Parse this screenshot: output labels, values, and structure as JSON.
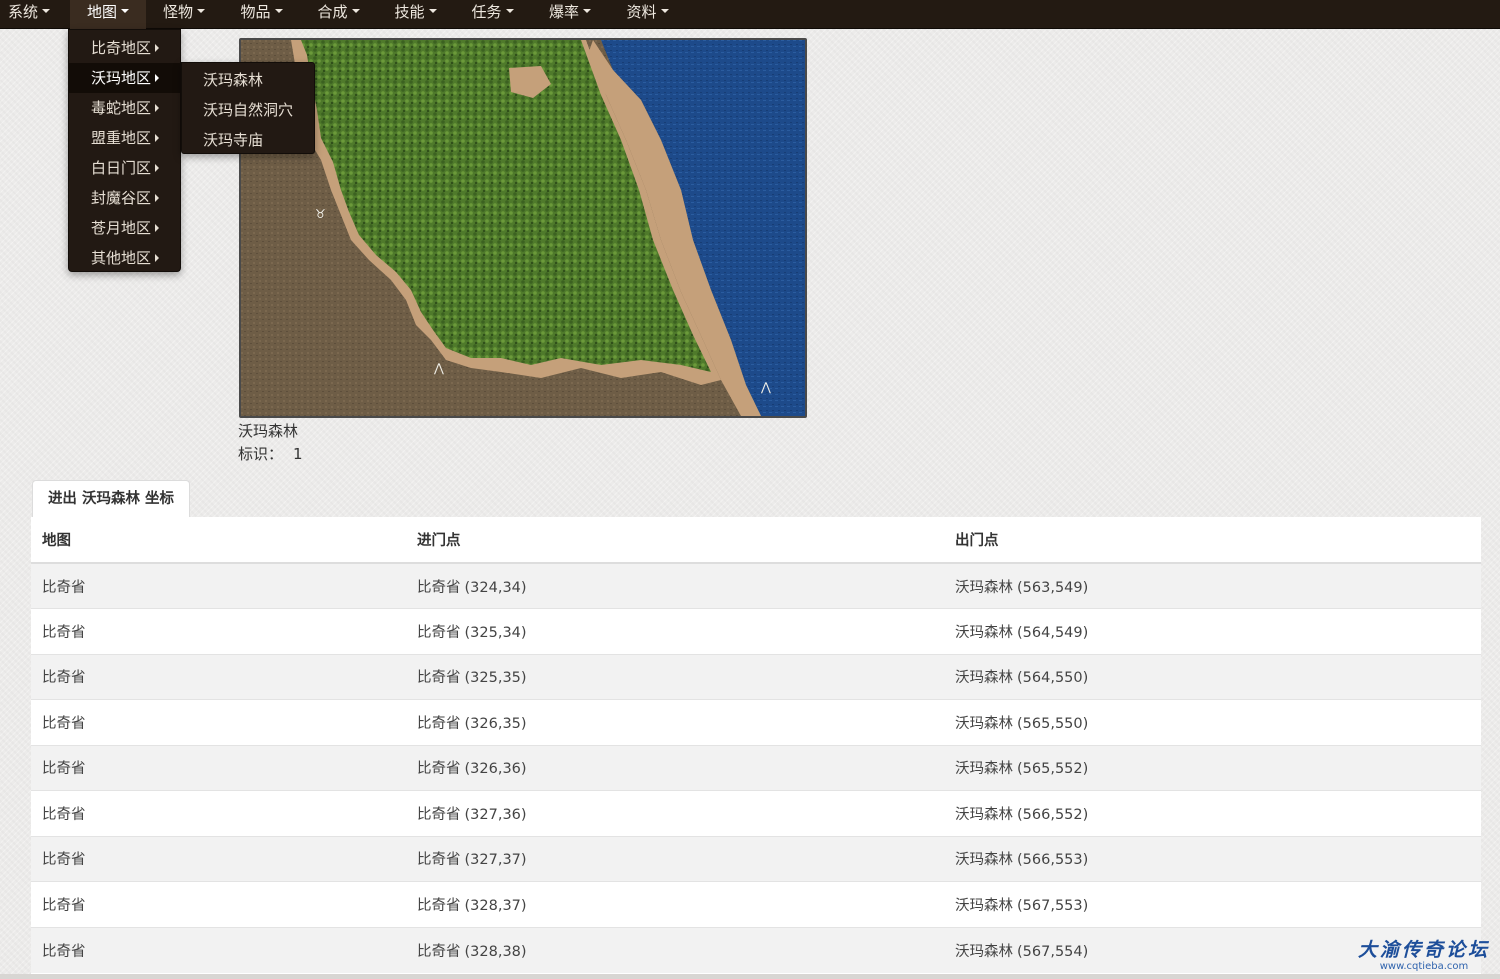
{
  "nav": {
    "items": [
      {
        "label": "系统"
      },
      {
        "label": "地图"
      },
      {
        "label": "怪物"
      },
      {
        "label": "物品"
      },
      {
        "label": "合成"
      },
      {
        "label": "技能"
      },
      {
        "label": "任务"
      },
      {
        "label": "爆率"
      },
      {
        "label": "资料"
      }
    ],
    "active": "地图"
  },
  "dropdown": {
    "items": [
      {
        "label": "比奇地区"
      },
      {
        "label": "沃玛地区"
      },
      {
        "label": "毒蛇地区"
      },
      {
        "label": "盟重地区"
      },
      {
        "label": "白日门区"
      },
      {
        "label": "封魔谷区"
      },
      {
        "label": "苍月地区"
      },
      {
        "label": "其他地区"
      }
    ],
    "active": "沃玛地区"
  },
  "submenu": {
    "items": [
      {
        "label": "沃玛森林"
      },
      {
        "label": "沃玛自然洞穴"
      },
      {
        "label": "沃玛寺庙"
      }
    ]
  },
  "map": {
    "name": "沃玛森林",
    "id_label": "标识：",
    "id_value": "1"
  },
  "tab": {
    "label": "进出 沃玛森林 坐标"
  },
  "table": {
    "headers": {
      "map": "地图",
      "entry": "进门点",
      "exit": "出门点"
    },
    "rows": [
      {
        "map": "比奇省",
        "entry_map": "比奇省",
        "entry_coord": "(324,34)",
        "exit_map": "沃玛森林",
        "exit_coord": "(563,549)"
      },
      {
        "map": "比奇省",
        "entry_map": "比奇省",
        "entry_coord": "(325,34)",
        "exit_map": "沃玛森林",
        "exit_coord": "(564,549)"
      },
      {
        "map": "比奇省",
        "entry_map": "比奇省",
        "entry_coord": "(325,35)",
        "exit_map": "沃玛森林",
        "exit_coord": "(564,550)"
      },
      {
        "map": "比奇省",
        "entry_map": "比奇省",
        "entry_coord": "(326,35)",
        "exit_map": "沃玛森林",
        "exit_coord": "(565,550)"
      },
      {
        "map": "比奇省",
        "entry_map": "比奇省",
        "entry_coord": "(326,36)",
        "exit_map": "沃玛森林",
        "exit_coord": "(565,552)"
      },
      {
        "map": "比奇省",
        "entry_map": "比奇省",
        "entry_coord": "(327,36)",
        "exit_map": "沃玛森林",
        "exit_coord": "(566,552)"
      },
      {
        "map": "比奇省",
        "entry_map": "比奇省",
        "entry_coord": "(327,37)",
        "exit_map": "沃玛森林",
        "exit_coord": "(566,553)"
      },
      {
        "map": "比奇省",
        "entry_map": "比奇省",
        "entry_coord": "(328,37)",
        "exit_map": "沃玛森林",
        "exit_coord": "(567,553)"
      },
      {
        "map": "比奇省",
        "entry_map": "比奇省",
        "entry_coord": "(328,38)",
        "exit_map": "沃玛森林",
        "exit_coord": "(567,554)"
      }
    ]
  },
  "watermark": {
    "title": "大渝传奇论坛",
    "url": "www.cqtieba.com"
  }
}
